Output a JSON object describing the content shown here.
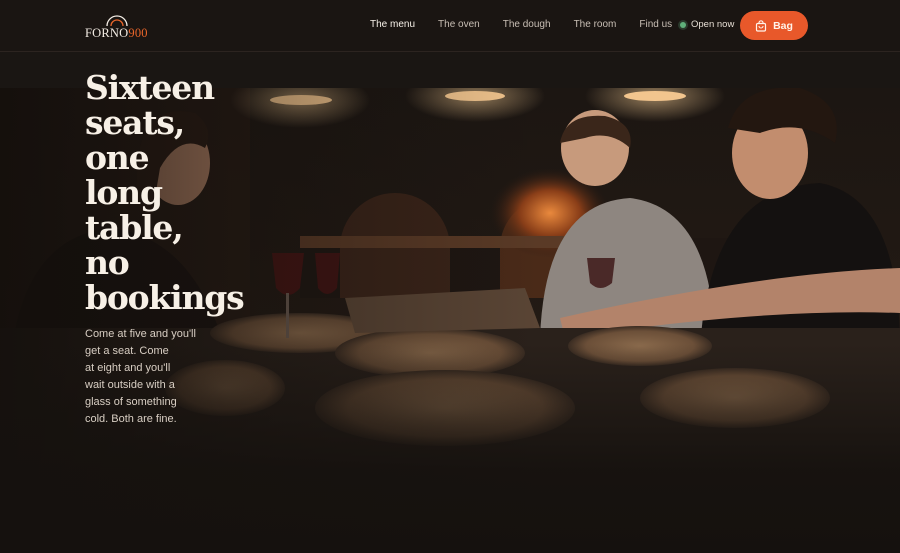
{
  "brand": {
    "name": "FORNO",
    "number": "900",
    "accent": "#e8652a"
  },
  "nav": {
    "items": [
      {
        "label": "The menu",
        "active": true
      },
      {
        "label": "The oven",
        "active": false
      },
      {
        "label": "The dough",
        "active": false
      },
      {
        "label": "The room",
        "active": false
      },
      {
        "label": "Find us",
        "active": false
      }
    ]
  },
  "status": {
    "label": "Open now",
    "color": "#5fb07a"
  },
  "cart": {
    "label": "Bag",
    "icon": "bag-icon",
    "color": "#e8582a"
  },
  "hero": {
    "headline_lines": [
      "Sixteen",
      "seats,",
      "one",
      "long",
      "table,",
      "no",
      "bookings"
    ],
    "lede_lines": [
      "Come at five and you'll",
      "get a seat. Come",
      "at eight and you'll",
      "wait outside with a",
      "glass of something",
      "cold. Both are fine."
    ],
    "image": "photo of diners laughing around a long table of pizzas under hanging lamps"
  }
}
